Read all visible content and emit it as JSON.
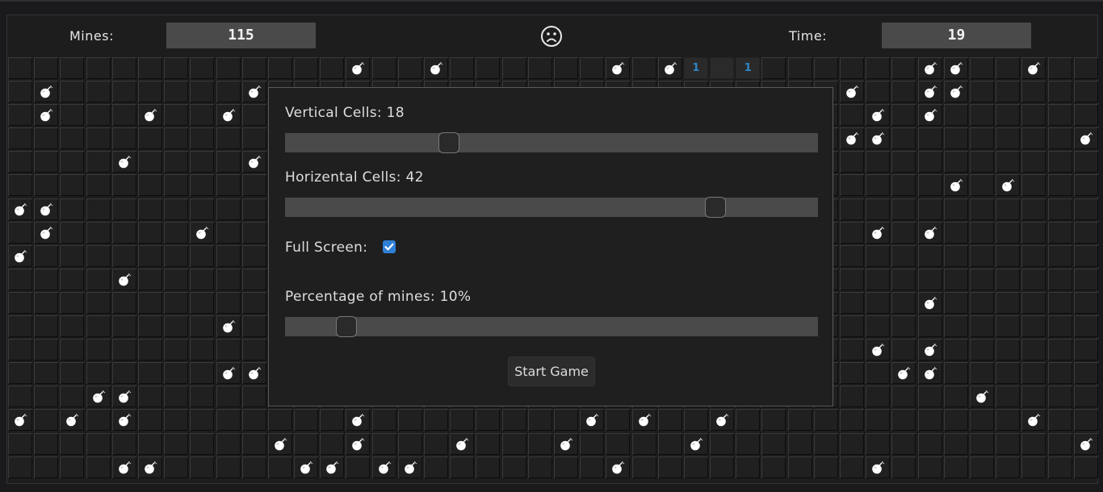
{
  "header": {
    "mines_label": "Mines:",
    "mines_value": "115",
    "time_label": "Time:",
    "time_value": "19",
    "face": "sad-face"
  },
  "settings": {
    "vertical": {
      "label": "Vertical Cells:",
      "value": "18",
      "min": 5,
      "max": 30,
      "fraction": 0.3
    },
    "horizontal": {
      "label": "Horizental Cells:",
      "value": "42",
      "min": 5,
      "max": 50,
      "fraction": 0.82
    },
    "fullscreen": {
      "label": "Full Screen:",
      "checked": true
    },
    "mines": {
      "label": "Percentage of mines:",
      "value": "10%",
      "fraction": 0.1
    },
    "start_label": "Start Game"
  },
  "board": {
    "rows": 18,
    "cols": 42,
    "mines": [
      [
        0,
        13
      ],
      [
        0,
        16
      ],
      [
        0,
        23
      ],
      [
        0,
        25
      ],
      [
        0,
        35
      ],
      [
        0,
        36
      ],
      [
        0,
        39
      ],
      [
        1,
        1
      ],
      [
        1,
        9
      ],
      [
        1,
        32
      ],
      [
        1,
        35
      ],
      [
        1,
        36
      ],
      [
        2,
        1
      ],
      [
        2,
        5
      ],
      [
        2,
        8
      ],
      [
        2,
        33
      ],
      [
        2,
        35
      ],
      [
        3,
        32
      ],
      [
        3,
        33
      ],
      [
        3,
        41
      ],
      [
        4,
        4
      ],
      [
        4,
        9
      ],
      [
        5,
        36
      ],
      [
        5,
        38
      ],
      [
        6,
        0
      ],
      [
        6,
        1
      ],
      [
        7,
        1
      ],
      [
        7,
        7
      ],
      [
        7,
        33
      ],
      [
        7,
        35
      ],
      [
        8,
        0
      ],
      [
        9,
        4
      ],
      [
        10,
        35
      ],
      [
        11,
        8
      ],
      [
        12,
        33
      ],
      [
        12,
        35
      ],
      [
        13,
        8
      ],
      [
        13,
        9
      ],
      [
        13,
        34
      ],
      [
        13,
        35
      ],
      [
        14,
        3
      ],
      [
        14,
        4
      ],
      [
        14,
        37
      ],
      [
        15,
        0
      ],
      [
        15,
        2
      ],
      [
        15,
        4
      ],
      [
        15,
        13
      ],
      [
        15,
        22
      ],
      [
        15,
        24
      ],
      [
        15,
        27
      ],
      [
        15,
        39
      ],
      [
        16,
        10
      ],
      [
        16,
        13
      ],
      [
        16,
        17
      ],
      [
        16,
        21
      ],
      [
        16,
        26
      ],
      [
        16,
        41
      ],
      [
        17,
        4
      ],
      [
        17,
        5
      ],
      [
        17,
        11
      ],
      [
        17,
        12
      ],
      [
        17,
        14
      ],
      [
        17,
        15
      ],
      [
        17,
        23
      ],
      [
        17,
        33
      ]
    ],
    "numbers": [
      {
        "r": 0,
        "c": 26,
        "n": "1"
      },
      {
        "r": 0,
        "c": 28,
        "n": "1"
      }
    ],
    "open": [
      [
        0,
        27
      ]
    ],
    "colors": {
      "number": "#2f86c8",
      "bomb": "#ffffff"
    }
  }
}
